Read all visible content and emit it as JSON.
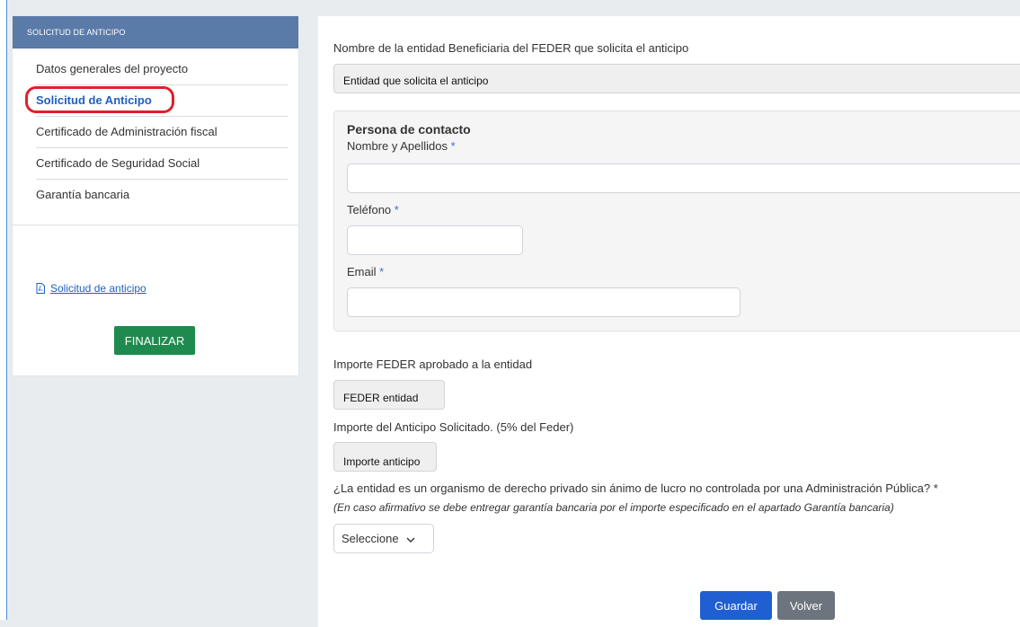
{
  "sidebar": {
    "header": "SOLICITUD DE ANTICIPO",
    "items": [
      {
        "label": "Datos generales del proyecto"
      },
      {
        "label": "Solicitud de Anticipo"
      },
      {
        "label": "Certificado de Administración fiscal"
      },
      {
        "label": "Certificado de Seguridad Social"
      },
      {
        "label": "Garantía bancaria"
      }
    ],
    "doc_link": "Solicitud de anticipo",
    "finalize_label": "FINALIZAR"
  },
  "form": {
    "entity_label": "Nombre de la entidad Beneficiaria del FEDER que solicita el anticipo",
    "entity_value": "Entidad que solicita el anticipo",
    "contact": {
      "title": "Persona de contacto",
      "name_label": "Nombre y Apellidos",
      "phone_label": "Teléfono",
      "email_label": "Email",
      "required_mark": "*",
      "name_value": "",
      "phone_value": "",
      "email_value": ""
    },
    "feder_label": "Importe FEDER aprobado a la entidad",
    "feder_value": "FEDER entidad",
    "advance_label": "Importe del Anticipo Solicitado. (5% del Feder)",
    "advance_value": "Importe anticipo",
    "question": "¿La entidad es un organismo de derecho privado sin ánimo de lucro no controlada por una Administración Pública? *",
    "hint": "(En caso afirmativo se debe entregar garantía bancaria por el importe especificado en el apartado Garantía bancaria)",
    "select_value": "Seleccione",
    "save_label": "Guardar",
    "back_label": "Volver"
  },
  "colors": {
    "header_bg": "#5a7aa8",
    "active_link": "#1f5fbf",
    "highlight_ring": "#e0202a",
    "finalize_bg": "#1e8a4e",
    "save_bg": "#1f5fd1",
    "back_bg": "#6c757d"
  }
}
